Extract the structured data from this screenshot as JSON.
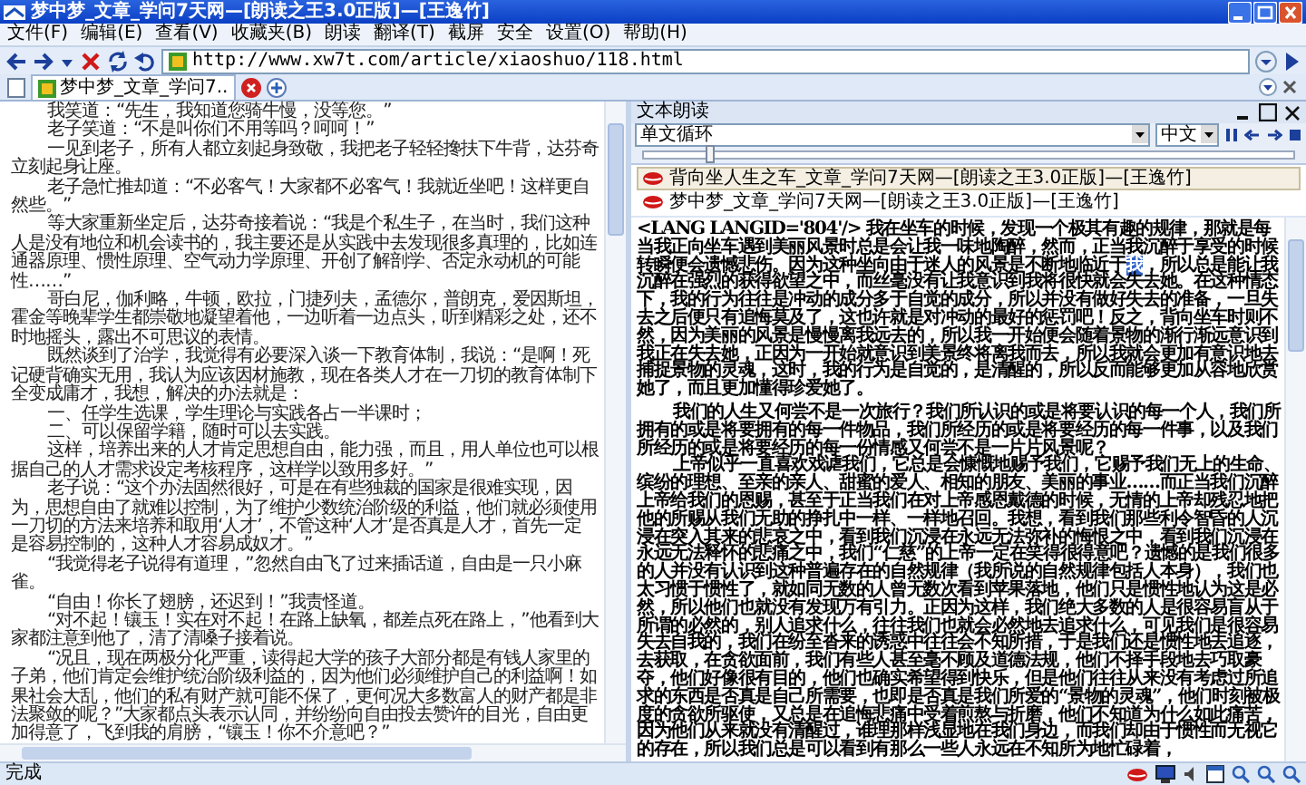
{
  "window": {
    "title": "梦中梦_文章_学问7天网—[朗读之王3.0正版]—[王逸竹]"
  },
  "menu": [
    "文件(F)",
    "编辑(E)",
    "查看(V)",
    "收藏夹(B)",
    "朗读",
    "翻译(T)",
    "截屏",
    "安全",
    "设置(O)",
    "帮助(H)"
  ],
  "address_bar": {
    "url": "http://www.xw7t.com/article/xiaoshuo/118.html"
  },
  "tabs": [
    {
      "label": "梦中梦_文章_学问7..",
      "selected": true
    }
  ],
  "article": {
    "paragraphs": [
      "我笑道：“先生，我知道您骑牛慢，没等您。”",
      "老子笑道：“不是叫你们不用等吗？呵呵！”",
      "一见到老子，所有人都立刻起身致敬，我把老子轻轻搀扶下牛背，达芬奇立刻起身让座。",
      "老子急忙推却道：“不必客气！大家都不必客气！我就近坐吧！这样更自然些。”",
      "等大家重新坐定后，达芬奇接着说：“我是个私生子，在当时，我们这种人是没有地位和机会读书的，我主要还是从实践中去发现很多真理的，比如连通器原理、惯性原理、空气动力学原理、开创了解剖学、否定永动机的可能性……”",
      "哥白尼，伽利略，牛顿，欧拉，门捷列夫，孟德尔，普朗克，爱因斯坦，霍金等晚辈学生都崇敬地凝望着他，一边听着一边点头，听到精彩之处，还不时地摇头，露出不可思议的表情。",
      "既然谈到了治学，我觉得有必要深入谈一下教育体制，我说：“是啊！死记硬背确实无用，我认为应该因材施教，现在各类人才在一刀切的教育体制下全变成庸才，我想，解决的办法就是：",
      "一、任学生选课，学生理论与实践各占一半课时；",
      "二、可以保留学籍，随时可以去实践。",
      "这样，培养出来的人才肯定思想自由，能力强，而且，用人单位也可以根据自己的人才需求设定考核程序，这样学以致用多好。”",
      "老子说：“这个办法固然很好，可是在有些独裁的国家是很难实现，因为，思想自由了就难以控制，为了维护少数统治阶级的利益，他们就必须使用一刀切的方法来培养和取用‘人才’，不管这种‘人才’是否真是人才，首先一定是容易控制的，这种人才容易成奴才。”",
      "“我觉得老子说得有道理，”忽然自由飞了过来插话道，自由是一只小麻雀。",
      "“自由！你长了翅膀，还迟到！”我责怪道。",
      "“对不起！镶玉！实在对不起！在路上缺氧，都差点死在路上，”他看到大家都注意到他了，清了清嗓子接着说。",
      "“况且，现在两极分化严重，读得起大学的孩子大部分都是有钱人家里的子弟，他们肯定会维护统治阶级利益的，因为他们必须维护自己的利益啊！如果社会大乱，他们的私有财产就可能不保了，更何况大多数富人的财产都是非法聚敛的呢？”大家都点头表示认同，并纷纷向自由投去赞许的目光，自由更加得意了，飞到我的肩膀，“镶玉！你不介意吧？”"
    ]
  },
  "reader_panel": {
    "title": "文本朗读",
    "mode": "单文循环",
    "language": "中文",
    "slider": {
      "level": 0.1
    },
    "playlist": [
      {
        "label": "背向坐人生之车_文章_学问7天网—[朗读之王3.0正版]—[王逸竹]",
        "selected": true
      },
      {
        "label": "梦中梦_文章_学问7天网—[朗读之王3.0正版]—[王逸竹]",
        "selected": false
      }
    ],
    "text": [
      {
        "segments": [
          {
            "text": "<LANG LANGID='804'/> 我在坐车的时候，发现一个极其有趣的规律，那就是每当我正向坐车遇到美丽风景时总是会让我一味地陶醉，然而，正当我沉醉于享受的时候转瞬便会遗憾悲伤。因为这种坐向由于迷人的风景是不断地临近于",
            "highlighted": false
          },
          {
            "text": "我",
            "highlighted": true
          },
          {
            "text": "，所以总是能让我沉醉在强烈的获得欲望之中，而丝毫没有让我意识到我将很快就会失去她。在这种情态下，我的行为往往是冲动的成分多于自觉的成分，所以并没有做好失去的准备，一旦失去之后便只有追悔莫及了，这也许就是对冲动的最好的惩罚吧！反之，背向坐车时则不然，因为美丽的风景是慢慢离我远去的，所以我一开始便会随着景物的渐行渐远意识到我正在失去她，正因为一开始就意识到美景终将离我而去，所以我就会更加有意识地去捕捉景物的灵魂，这时，我的行为是自觉的，是清醒的，所以反而能够更加从容地欣赏她了，而且更加懂得珍爱她了。",
            "highlighted": false
          }
        ]
      },
      {
        "segments": [
          {
            "text": "我们的人生又何尝不是一次旅行？我们所认识的或是将要认识的每一个人，我们所拥有的或是将要拥有的每一件物品，我们所经历的或是将要经历的每一件事，以及我们所经历的或是将要经历的每一份情感又何尝不是一片片风景呢？",
            "highlighted": false
          }
        ]
      },
      {
        "segments": [
          {
            "text": "上帝似乎一直喜欢戏谑我们，它总是会慷慨地赐予我们，它赐予我们无上的生命、缤纷的理想、至亲的亲人、甜蜜的爱人、相知的朋友、美丽的事业……而正当我们沉醉上帝给我们的恩赐，甚至于正当我们在对上帝感恩戴德的时候，无情的上帝却残忍地把他的所赐从我们无助的挣扎中一样、一样地召回。我想，看到我们那些利令智昏的人沉浸在突入其来的悲哀之中，看到我们沉浸在永远无法弥补的悔恨之中，看到我们沉浸在永远无法释怀的悲痛之中，我们“仁慈”的上帝一定在笑得很得意吧？遗憾的是我们很多的人并没有认识到这种普遍存在的自然规律（我所说的自然规律包括人本身），我们也太习惯于惯性了，就如同无数的人曾无数次看到苹果落地，他们只是惯性地认为这是必然，所以他们也就没有发现万有引力。正因为这样，我们绝大多数的人是很容易盲从于所谓的必然的，别人追求什么，往往我们也就会必然地去追求什么，可见我们是很容易失去自我的，我们在纷至沓来的诱惑中往往会不知所措，于是我们还是惯性地去追逐，去获取，在贪欲面前，我们有些人甚至毫不顾及道德法规，他们不择手段地去巧取豪夺，他们好像很有目的，他们也确实希望得到快乐，但是他们往往从来没有考虑过所追求的东西是否真是自己所需要，也即是否真是我们所爱的“景物的灵魂”，他们时刻被极度的贪欲所驱使，又总是在追悔悲痛中受着煎熬与折磨，他们不知道为什么如此痛苦，因为他们从来就没有清醒过，谁理那样浅显地在我们身边，而我们却由于惯性而无视它的存在，所以我们总是可以看到有那么一些人永远在不知所为地忙碌着，",
            "highlighted": false
          }
        ]
      }
    ]
  },
  "status_bar": {
    "text": "完成"
  }
}
